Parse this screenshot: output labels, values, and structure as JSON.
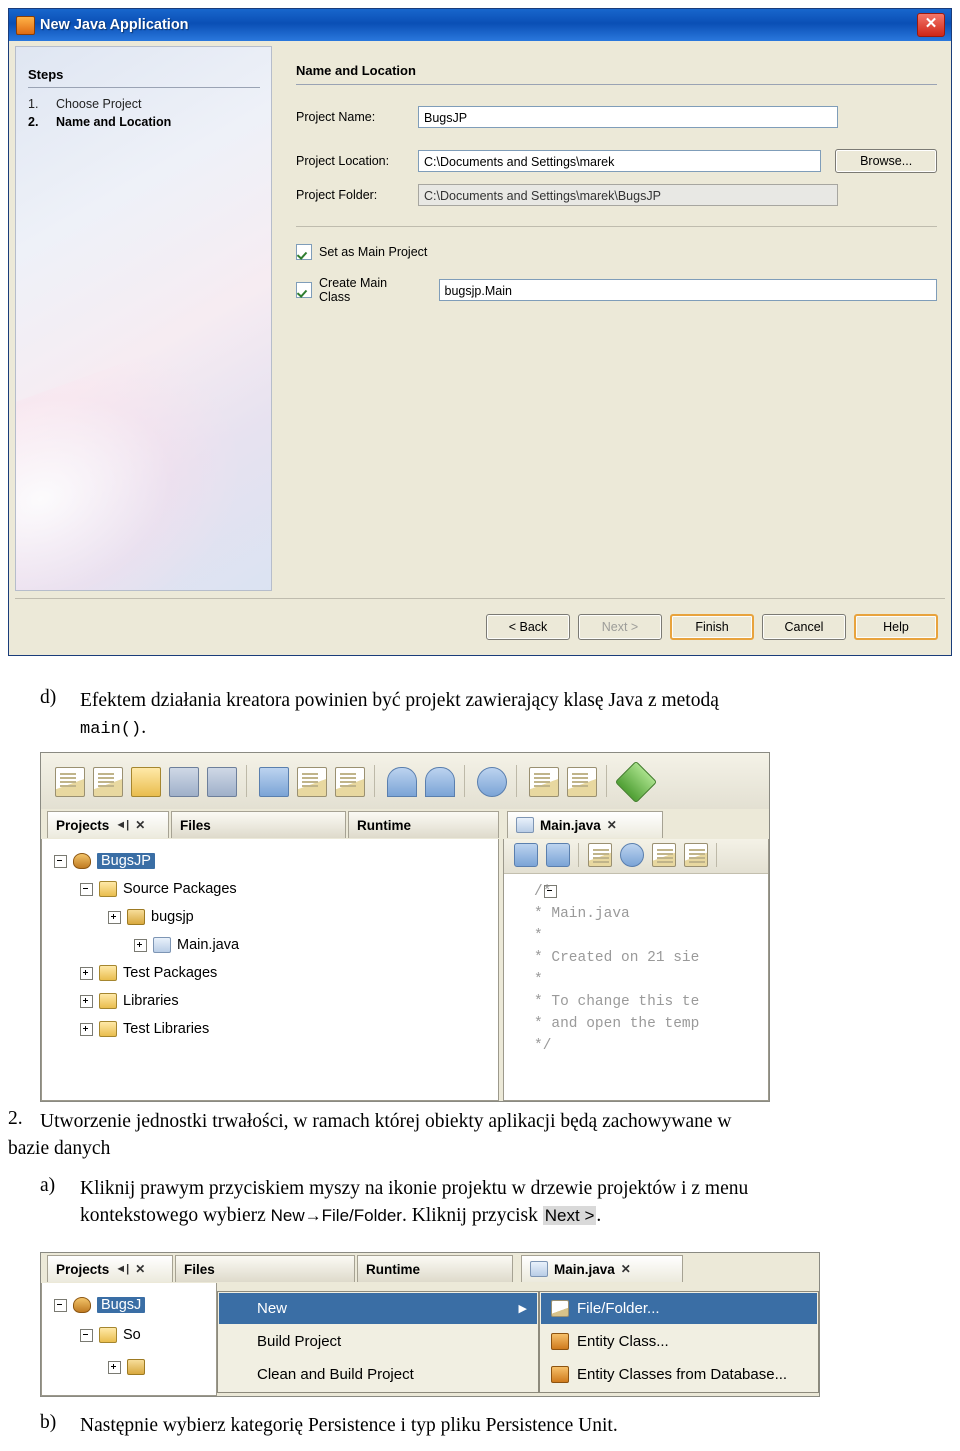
{
  "wizard": {
    "title": "New Java Application",
    "close_label": "✕",
    "steps_header": "Steps",
    "steps": [
      {
        "num": "1.",
        "label": "Choose Project"
      },
      {
        "num": "2.",
        "label": "Name and Location"
      }
    ],
    "panel_title": "Name and Location",
    "fields": [
      {
        "label": "Project Name:",
        "value": "BugsJP"
      },
      {
        "label": "Project Location:",
        "value": "C:\\Documents and Settings\\marek"
      },
      {
        "label": "Project Folder:",
        "value": "C:\\Documents and Settings\\marek\\BugsJP"
      }
    ],
    "browse_button": "Browse...",
    "checkboxes": [
      {
        "label": "Set as Main Project",
        "checked": true
      },
      {
        "label": "Create Main Class",
        "checked": true
      }
    ],
    "main_class_value": "bugsjp.Main",
    "buttons": [
      {
        "label": "< Back",
        "state": "enabled"
      },
      {
        "label": "Next >",
        "state": "disabled"
      },
      {
        "label": "Finish",
        "state": "default"
      },
      {
        "label": "Cancel",
        "state": "enabled"
      },
      {
        "label": "Help",
        "state": "default"
      }
    ]
  },
  "text": {
    "item_d_marker": "d)",
    "item_d": "Efektem działania kreatora powinien być projekt zawierający klasę Java z metodą",
    "item_d_line2_pre": "main()",
    "item_d_line2_post": ".",
    "item_2_marker": "2.",
    "item_2_line1": "Utworzenie jednostki trwałości, w ramach której obiekty aplikacji będą zachowywane w",
    "item_2_line2": "bazie danych",
    "item_a_marker": "a)",
    "item_a_line1": "Kliknij prawym przyciskiem myszy na ikonie projektu w drzewie projektów i z menu",
    "item_a_line2_pre": "kontekstowego wybierz ",
    "item_a_line2_mid": "New→File/Folder",
    "item_a_line2_post": ". Kliknij przycisk ",
    "item_a_line2_kbd": "Next >",
    "item_a_line2_end": ".",
    "item_b_marker": "b)",
    "item_b": "Następnie wybierz kategorię Persistence i typ pliku Persistence Unit."
  },
  "nb1": {
    "tabs": [
      {
        "label": "Projects",
        "pin": "◄|",
        "close": "✕",
        "active": false
      },
      {
        "label": "Files",
        "active": false
      },
      {
        "label": "Runtime",
        "active": false
      },
      {
        "label": "Main.java",
        "close": "✕",
        "active": true
      }
    ],
    "tree": [
      {
        "label": "BugsJP",
        "indent": 0,
        "icon": "coffee-icon",
        "expander": "minus",
        "selected": true
      },
      {
        "label": "Source Packages",
        "indent": 1,
        "icon": "folder-icon",
        "expander": "minus",
        "selected": false
      },
      {
        "label": "bugsjp",
        "indent": 2,
        "icon": "package-icon",
        "expander": "plus",
        "selected": false
      },
      {
        "label": "Main.java",
        "indent": 3,
        "icon": "java-file-icon",
        "expander": "plus",
        "selected": false
      },
      {
        "label": "Test Packages",
        "indent": 1,
        "icon": "folder-icon",
        "expander": "plus",
        "selected": false
      },
      {
        "label": "Libraries",
        "indent": 1,
        "icon": "folder-icon",
        "expander": "plus",
        "selected": false
      },
      {
        "label": "Test Libraries",
        "indent": 1,
        "icon": "folder-icon",
        "expander": "plus",
        "selected": false
      }
    ],
    "code_lines": [
      "/*",
      " * Main.java",
      " *",
      " * Created on 21 sie",
      " *",
      " * To change this te",
      " * and open the temp",
      " */"
    ]
  },
  "nb2": {
    "tabs": [
      {
        "label": "Projects",
        "pin": "◄|",
        "close": "✕",
        "active": false
      },
      {
        "label": "Files",
        "active": false
      },
      {
        "label": "Runtime",
        "active": false
      },
      {
        "label": "Main.java",
        "close": "✕",
        "active": true
      }
    ],
    "tree": [
      {
        "label": "BugsJ",
        "indent": 0,
        "icon": "coffee-icon",
        "expander": "minus",
        "selected": true
      },
      {
        "label": "So",
        "indent": 1,
        "icon": "folder-icon",
        "expander": "minus",
        "selected": false
      },
      {
        "label": "",
        "indent": 2,
        "icon": "package-icon",
        "expander": "plus",
        "selected": false
      }
    ],
    "menu_items": [
      {
        "label": "New",
        "highlighted": true,
        "has_submenu": true,
        "caret": "▶"
      },
      {
        "label": "Build Project",
        "highlighted": false,
        "has_submenu": false
      },
      {
        "label": "Clean and Build Project",
        "highlighted": false,
        "has_submenu": false
      }
    ],
    "submenu_items": [
      {
        "label": "File/Folder...",
        "icon": "file-folder-icon",
        "highlighted": true
      },
      {
        "label": "Entity Class...",
        "icon": "entity-class-icon",
        "highlighted": false
      },
      {
        "label": "Entity Classes from Database...",
        "icon": "entity-db-icon",
        "highlighted": false
      }
    ]
  }
}
